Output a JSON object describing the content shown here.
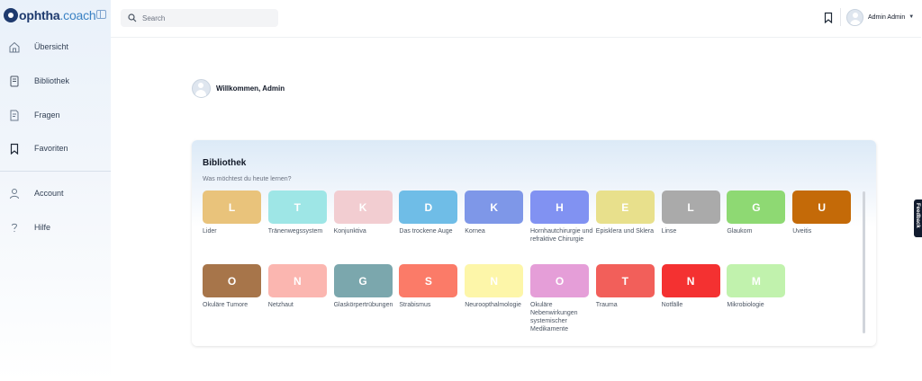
{
  "brand": {
    "name": "ophtha",
    "suffix": ".coach"
  },
  "sidebar": {
    "items": [
      {
        "label": "Übersicht",
        "icon": "home-icon"
      },
      {
        "label": "Bibliothek",
        "icon": "book-icon"
      },
      {
        "label": "Fragen",
        "icon": "question-sheet-icon"
      },
      {
        "label": "Favoriten",
        "icon": "bookmark-icon"
      },
      {
        "label": "Account",
        "icon": "user-icon"
      },
      {
        "label": "Hilfe",
        "icon": "help-icon"
      }
    ]
  },
  "header": {
    "search_placeholder": "Search",
    "user_name": "Admin Admin",
    "caret": "▼"
  },
  "welcome": {
    "text": "Willkommen, Admin"
  },
  "library": {
    "title": "Bibliothek",
    "subtitle": "Was möchtest du heute lernen?",
    "tiles": [
      {
        "letter": "L",
        "label": "Lider",
        "color": "#e9c37b"
      },
      {
        "letter": "T",
        "label": "Tränenwegssystem",
        "color": "#9ee6e6"
      },
      {
        "letter": "K",
        "label": "Konjunktiva",
        "color": "#f2cdd1"
      },
      {
        "letter": "D",
        "label": "Das trockene Auge",
        "color": "#6fbde7"
      },
      {
        "letter": "K",
        "label": "Kornea",
        "color": "#7e97e8"
      },
      {
        "letter": "H",
        "label": "Hornhautchirurgie und refraktive Chirurgie",
        "color": "#8192f2"
      },
      {
        "letter": "E",
        "label": "Episklera und Sklera",
        "color": "#e8e08c"
      },
      {
        "letter": "L",
        "label": "Linse",
        "color": "#aaaaaa"
      },
      {
        "letter": "G",
        "label": "Glaukom",
        "color": "#8ed973"
      },
      {
        "letter": "U",
        "label": "Uveitis",
        "color": "#c46a08"
      },
      {
        "letter": "O",
        "label": "Okuläre Tumore",
        "color": "#a7754a"
      },
      {
        "letter": "N",
        "label": "Netzhaut",
        "color": "#fbb6b0"
      },
      {
        "letter": "G",
        "label": "Glaskörpertrübungen",
        "color": "#7ba7ad"
      },
      {
        "letter": "S",
        "label": "Strabismus",
        "color": "#fb7b68"
      },
      {
        "letter": "N",
        "label": "Neuroopthalmologie",
        "color": "#fdf6a9"
      },
      {
        "letter": "O",
        "label": "Okuläre Nebenwirkungen systemischer Medikamente",
        "color": "#e59ed8"
      },
      {
        "letter": "T",
        "label": "Trauma",
        "color": "#f25f5a"
      },
      {
        "letter": "N",
        "label": "Notfälle",
        "color": "#f43131"
      },
      {
        "letter": "M",
        "label": "Mikrobiologie",
        "color": "#c1f2ad"
      }
    ]
  },
  "feedback": {
    "label": "Feedback"
  }
}
